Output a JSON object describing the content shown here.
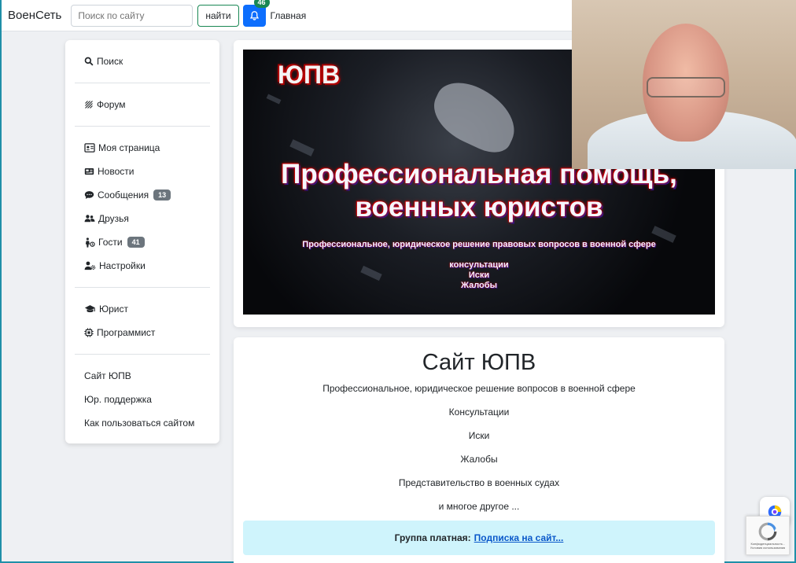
{
  "navbar": {
    "brand": "ВоенСеть",
    "search_placeholder": "Поиск по сайту",
    "search_button": "найти",
    "notifications_count": "46",
    "home_link": "Главная"
  },
  "sidebar": {
    "search": "Поиск",
    "forum": "Форум",
    "my_page": "Моя страница",
    "news": "Новости",
    "messages": "Сообщения",
    "messages_count": "13",
    "friends": "Друзья",
    "guests": "Гости",
    "guests_count": "41",
    "settings": "Настройки",
    "lawyer": "Юрист",
    "programmer": "Программист",
    "site": "Сайт ЮПВ",
    "support": "Юр. поддержка",
    "howto": "Как пользоваться сайтом"
  },
  "banner": {
    "logo": "ЮПВ",
    "title_line1": "Профессиональная помощь,",
    "title_line2": "военных юристов",
    "subtitle": "Профессиональное, юридическое решение правовых вопросов в военной сфере",
    "item1": "консультации",
    "item2": "Иски",
    "item3": "Жалобы"
  },
  "content": {
    "title": "Сайт ЮПВ",
    "line1": "Профессиональное, юридическое решение вопросов в военной сфере",
    "line2": "Консультации",
    "line3": "Иски",
    "line4": "Жалобы",
    "line5": "Представительство в военных судах",
    "line6": "и многое другое ...",
    "alert_text": "Группа платная:",
    "alert_link": "Подписка на сайт..."
  },
  "recaptcha": {
    "text": "Конфиденциальность - Условия использования"
  },
  "colors": {
    "primary": "#0d6efd",
    "success": "#198754",
    "secondary": "#6c757d",
    "info_bg": "#cff4fc"
  }
}
